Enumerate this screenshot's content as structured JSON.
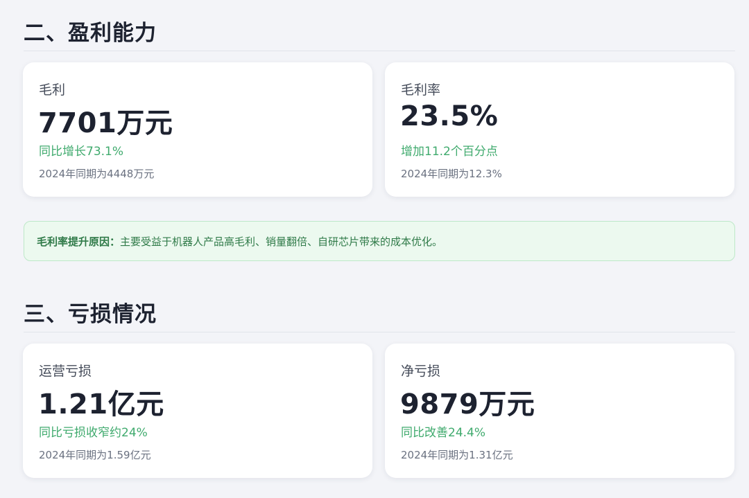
{
  "sections": [
    {
      "title": "二、盈利能力",
      "cards": [
        {
          "label": "毛利",
          "value": "7701万元",
          "change": "同比增长73.1%",
          "prior": "2024年同期为4448万元"
        },
        {
          "label": "毛利率",
          "value": "23.5%",
          "change": "增加11.2个百分点",
          "prior": "2024年同期为12.3%"
        }
      ],
      "note": {
        "key": "毛利率提升原因：",
        "text": "主要受益于机器人产品高毛利、销量翻倍、自研芯片带来的成本优化。"
      }
    },
    {
      "title": "三、亏损情况",
      "cards": [
        {
          "label": "运营亏损",
          "value": "1.21亿元",
          "change": "同比亏损收窄约24%",
          "prior": "2024年同期为1.59亿元"
        },
        {
          "label": "净亏损",
          "value": "9879万元",
          "change": "同比改善24.4%",
          "prior": "2024年同期为1.31亿元"
        }
      ]
    }
  ],
  "colors": {
    "background": "#f3f4f8",
    "card": "#ffffff",
    "positive_text": "#3faa6d",
    "note_background": "#ecf9ef",
    "note_border": "#bde8c8",
    "note_text": "#2f7a48"
  }
}
